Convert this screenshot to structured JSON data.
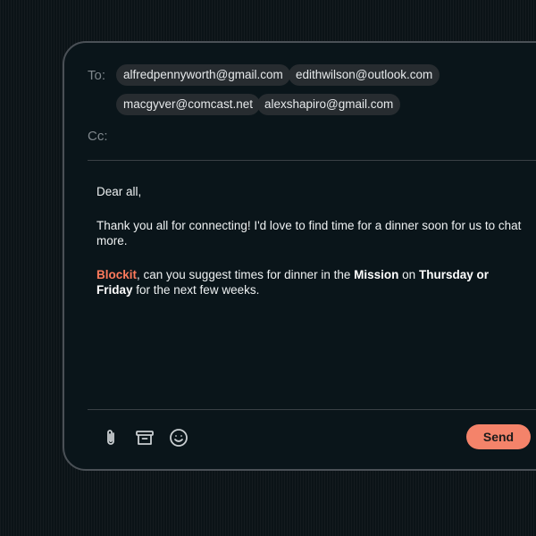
{
  "compose": {
    "to_label": "To:",
    "cc_label": "Cc:",
    "recipients": [
      "alfredpennyworth@gmail.com",
      "edithwilson@outlook.com",
      "macgyver@comcast.net",
      "alexshapiro@gmail.com"
    ],
    "body": {
      "greeting": "Dear all,",
      "line1": "Thank you all for connecting! I'd love to find time for a dinner soon for us to chat more.",
      "mention": "Blockit",
      "part1": ", can you suggest times for dinner in the ",
      "location": "Mission",
      "part2": " on ",
      "days": "Thursday or Friday",
      "part3": " for the next few weeks."
    }
  },
  "toolbar": {
    "icons": [
      "paperclip-icon",
      "archive-icon",
      "emoji-icon"
    ],
    "send_label": "Send"
  },
  "colors": {
    "background": "#0b1317",
    "window": "#0a151a",
    "chip": "#272c30",
    "accent": "#ff7a5c",
    "send": "#f4836a"
  }
}
